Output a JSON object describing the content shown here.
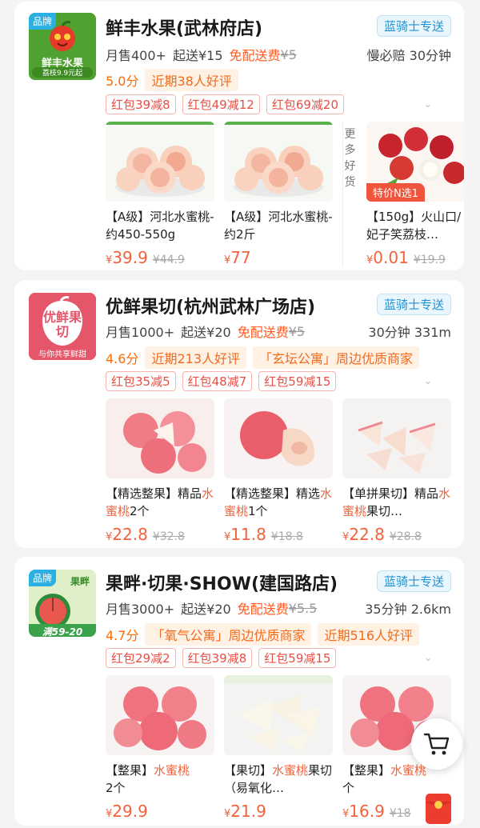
{
  "stores": [
    {
      "brand_tag": "品牌",
      "logo_text": "鲜丰水果",
      "logo_sub": "荔枝9.9元起",
      "name": "鲜丰水果(武林府店)",
      "delivery": "蓝骑士专送",
      "sales": "月售400+",
      "min_order": "起送¥15",
      "free_delivery": "免配送费",
      "old_fee": "¥5",
      "right_info": "慢必赔  30分钟",
      "score": "5.0分",
      "chips": [
        "近期38人好评"
      ],
      "coupons": [
        "红包39减8",
        "红包49减12",
        "红包69减20"
      ],
      "more_label": "更多好货",
      "products": [
        {
          "title_a": "【A级】河北水蜜桃-约450-550g",
          "title_hl": "",
          "title_b": "",
          "yen": "¥",
          "price": "39.9",
          "old": "¥44.9",
          "badge": ""
        },
        {
          "title_a": "【A级】河北水蜜桃-约2斤",
          "title_hl": "",
          "title_b": "",
          "yen": "¥",
          "price": "77",
          "old": "",
          "badge": ""
        },
        {
          "title_a": "【150g】火山口/妃子笑荔枝…",
          "title_hl": "",
          "title_b": "",
          "yen": "¥",
          "price": "0.01",
          "old": "¥19.9",
          "badge": "特价N选1"
        }
      ]
    },
    {
      "brand_tag": "",
      "logo_text": "优鲜果切",
      "logo_sub": "与你共享鲜甜",
      "name": "优鲜果切(杭州武林广场店)",
      "delivery": "蓝骑士专送",
      "sales": "月售1000+",
      "min_order": "起送¥20",
      "free_delivery": "免配送费",
      "old_fee": "¥5",
      "right_info": "30分钟  331m",
      "score": "4.6分",
      "chips": [
        "近期213人好评",
        "「玄坛公寓」周边优质商家"
      ],
      "coupons": [
        "红包35减5",
        "红包48减7",
        "红包59减15"
      ],
      "products": [
        {
          "title_a": "【精选整果】精品",
          "title_hl": "水蜜桃",
          "title_b": "2个",
          "yen": "¥",
          "price": "22.8",
          "old": "¥32.8",
          "badge": ""
        },
        {
          "title_a": "【精选整果】精选",
          "title_hl": "水蜜桃",
          "title_b": "1个",
          "yen": "¥",
          "price": "11.8",
          "old": "¥18.8",
          "badge": ""
        },
        {
          "title_a": "【单拼果切】精品",
          "title_hl": "水蜜桃",
          "title_b": "果切…",
          "yen": "¥",
          "price": "22.8",
          "old": "¥28.8",
          "badge": ""
        }
      ]
    },
    {
      "brand_tag": "品牌",
      "logo_text": "果畔",
      "logo_sub": "满59-20",
      "name": "果畔·切果·SHOW(建国路店)",
      "delivery": "蓝骑士专送",
      "sales": "月售3000+",
      "min_order": "起送¥20",
      "free_delivery": "免配送费",
      "old_fee": "¥5.5",
      "right_info": "35分钟  2.6km",
      "score": "4.7分",
      "chips": [
        "「氧气公寓」周边优质商家",
        "近期516人好评"
      ],
      "coupons": [
        "红包29减2",
        "红包39减8",
        "红包59减15"
      ],
      "products": [
        {
          "title_a": "【整果】",
          "title_hl": "水蜜桃",
          "title_b": "2个",
          "yen": "¥",
          "price": "29.9",
          "old": "",
          "badge": ""
        },
        {
          "title_a": "【果切】",
          "title_hl": "水蜜桃",
          "title_b": "果切（易氧化…",
          "yen": "¥",
          "price": "21.9",
          "old": "",
          "badge": ""
        },
        {
          "title_a": "【整果】",
          "title_hl": "水蜜桃",
          "title_b": "个",
          "yen": "¥",
          "price": "16.9",
          "old": "¥18",
          "badge": ""
        }
      ]
    }
  ],
  "colors": {
    "accent": "#f2623c",
    "delivery": "#1b93d6",
    "score": "#ff6a00"
  }
}
